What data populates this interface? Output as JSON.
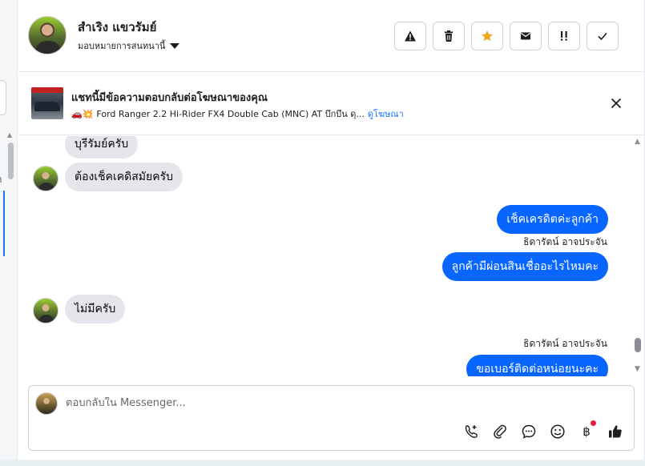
{
  "header": {
    "contact_name": "สำเริง แขวรัมย์",
    "assign_label": "มอบหมายการสนทนานี้"
  },
  "actions": [
    {
      "name": "report-spam-button",
      "icon": "warning-icon"
    },
    {
      "name": "delete-button",
      "icon": "trash-icon"
    },
    {
      "name": "star-button",
      "icon": "star-icon",
      "color": "#f5a623"
    },
    {
      "name": "mark-unread-button",
      "icon": "envelope-icon"
    },
    {
      "name": "follow-up-button",
      "icon": "double-exclamation-icon"
    },
    {
      "name": "done-button",
      "icon": "checkmark-icon"
    }
  ],
  "ad_banner": {
    "title": "แชทนี้มีข้อความตอบกลับต่อโฆษณาของคุณ",
    "subtitle": "Ford Ranger 2.2 Hi-Rider FX4 Double Cab (MNC) AT บึกบึน ดุ...",
    "emoji": "🚗💥",
    "link_label": "ดูโฆษณา"
  },
  "messages": [
    {
      "direction": "in",
      "text": "บุรีรัมย์ครับ"
    },
    {
      "direction": "in",
      "text": "ต้องเช็คเคดิสมัยครับ"
    },
    {
      "direction": "out",
      "text": "เช็คเครดิตค่ะลูกค้า"
    },
    {
      "direction": "sender",
      "text": "ธิดารัตน์ อาจประจัน"
    },
    {
      "direction": "out",
      "text": "ลูกค้ามีผ่อนสินเชื่ออะไรไหมคะ"
    },
    {
      "direction": "in",
      "text": "ไม่มีครับ"
    },
    {
      "direction": "sender",
      "text": "ธิดารัตน์ อาจประจัน"
    },
    {
      "direction": "out",
      "text": "ขอเบอร์ติดต่อหน่อยนะคะ"
    }
  ],
  "composer": {
    "placeholder": "ตอบกลับใน Messenger...",
    "tools": [
      "call-add-icon",
      "paperclip-icon",
      "chat-bubble-icon",
      "emoji-icon",
      "baht-icon",
      "thumbs-up-icon"
    ]
  },
  "colors": {
    "outgoing_bubble": "#0866ff",
    "incoming_bubble": "#e4e6eb",
    "link": "#1877f2",
    "notification_dot": "#e41e3f"
  }
}
